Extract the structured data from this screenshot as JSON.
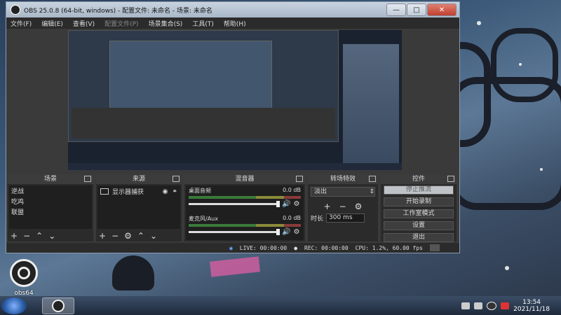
{
  "window": {
    "title": "OBS 25.0.8 (64-bit, windows) - 配置文件: 未命名 - 场景: 未命名"
  },
  "menu": [
    "文件(F)",
    "编辑(E)",
    "查看(V)",
    "配置文件(P)",
    "场景集合(S)",
    "工具(T)",
    "帮助(H)"
  ],
  "docks": {
    "scenes": {
      "title": "场景",
      "items": [
        "逆战",
        "吃鸡",
        "联盟"
      ]
    },
    "sources": {
      "title": "来源",
      "items": [
        {
          "name": "显示器捕获"
        }
      ]
    },
    "mixer": {
      "title": "混音器",
      "channels": [
        {
          "name": "桌面音频",
          "db": "0.0 dB"
        },
        {
          "name": "麦克风/Aux",
          "db": "0.0 dB"
        }
      ]
    },
    "transitions": {
      "title": "转场特效",
      "selected": "淡出",
      "duration_label": "时长",
      "duration_value": "300 ms"
    },
    "controls": {
      "title": "控件",
      "buttons": [
        "停止推流",
        "开始录制",
        "工作室模式",
        "设置",
        "退出"
      ]
    }
  },
  "status": {
    "live": "LIVE: 00:00:00",
    "rec": "REC: 00:00:00",
    "cpu": "CPU: 1.2%, 60.00 fps"
  },
  "desktop": {
    "icon_label": "obs64"
  },
  "taskbar": {
    "time": "13:54",
    "date": "2021/11/18"
  },
  "colors": {
    "accent": "#bfc3c8",
    "panel": "#2b2b2b"
  }
}
